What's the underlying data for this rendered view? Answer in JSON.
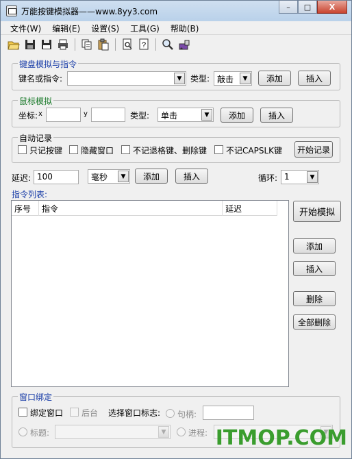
{
  "window": {
    "title": "万能按键模拟器——www.8yy3.com",
    "controls": {
      "minimize": "–",
      "maximize": "□",
      "close": "X"
    }
  },
  "menu": [
    "文件(W)",
    "编辑(E)",
    "设置(S)",
    "工具(G)",
    "帮助(B)"
  ],
  "toolbar_icons": [
    "open-folder-icon",
    "save-icon",
    "save-as-icon",
    "print-icon",
    "copy-icon",
    "paste-icon",
    "preview-icon",
    "help-icon",
    "search-icon",
    "tool-icon"
  ],
  "keyboard": {
    "legend": "键盘模拟与指令",
    "key_label": "键名或指令:",
    "key_value": "",
    "type_label": "类型:",
    "type_value": "敲击",
    "add": "添加",
    "insert": "插入"
  },
  "mouse": {
    "legend": "鼠标模拟",
    "coord_label": "坐标:",
    "x_label": "x",
    "x_value": "",
    "y_label": "y",
    "y_value": "",
    "type_label": "类型:",
    "type_value": "单击",
    "add": "添加",
    "insert": "插入"
  },
  "autorecord": {
    "legend": "自动记录",
    "opt1": "只记按键",
    "opt2": "隐藏窗口",
    "opt3": "不记退格键、删除键",
    "opt4": "不记CAPSLK键",
    "start": "开始记录"
  },
  "delay": {
    "label": "延迟:",
    "value": "100",
    "unit": "毫秒",
    "add": "添加",
    "insert": "插入",
    "loop_label": "循环:",
    "loop_value": "1"
  },
  "commands": {
    "label": "指令列表:",
    "columns": [
      "序号",
      "指令",
      "延迟"
    ],
    "rows": []
  },
  "side_buttons": {
    "start_sim": "开始模拟",
    "add": "添加",
    "insert": "插入",
    "delete": "删除",
    "delete_all": "全部删除"
  },
  "bind": {
    "legend": "窗口绑定",
    "bind_window": "绑定窗口",
    "background": "后台",
    "select_flag": "选择窗口标志:",
    "handle": "句柄:",
    "handle_value": "",
    "title": "标题:",
    "process": "进程:"
  },
  "watermark": "ITMOP.COM"
}
